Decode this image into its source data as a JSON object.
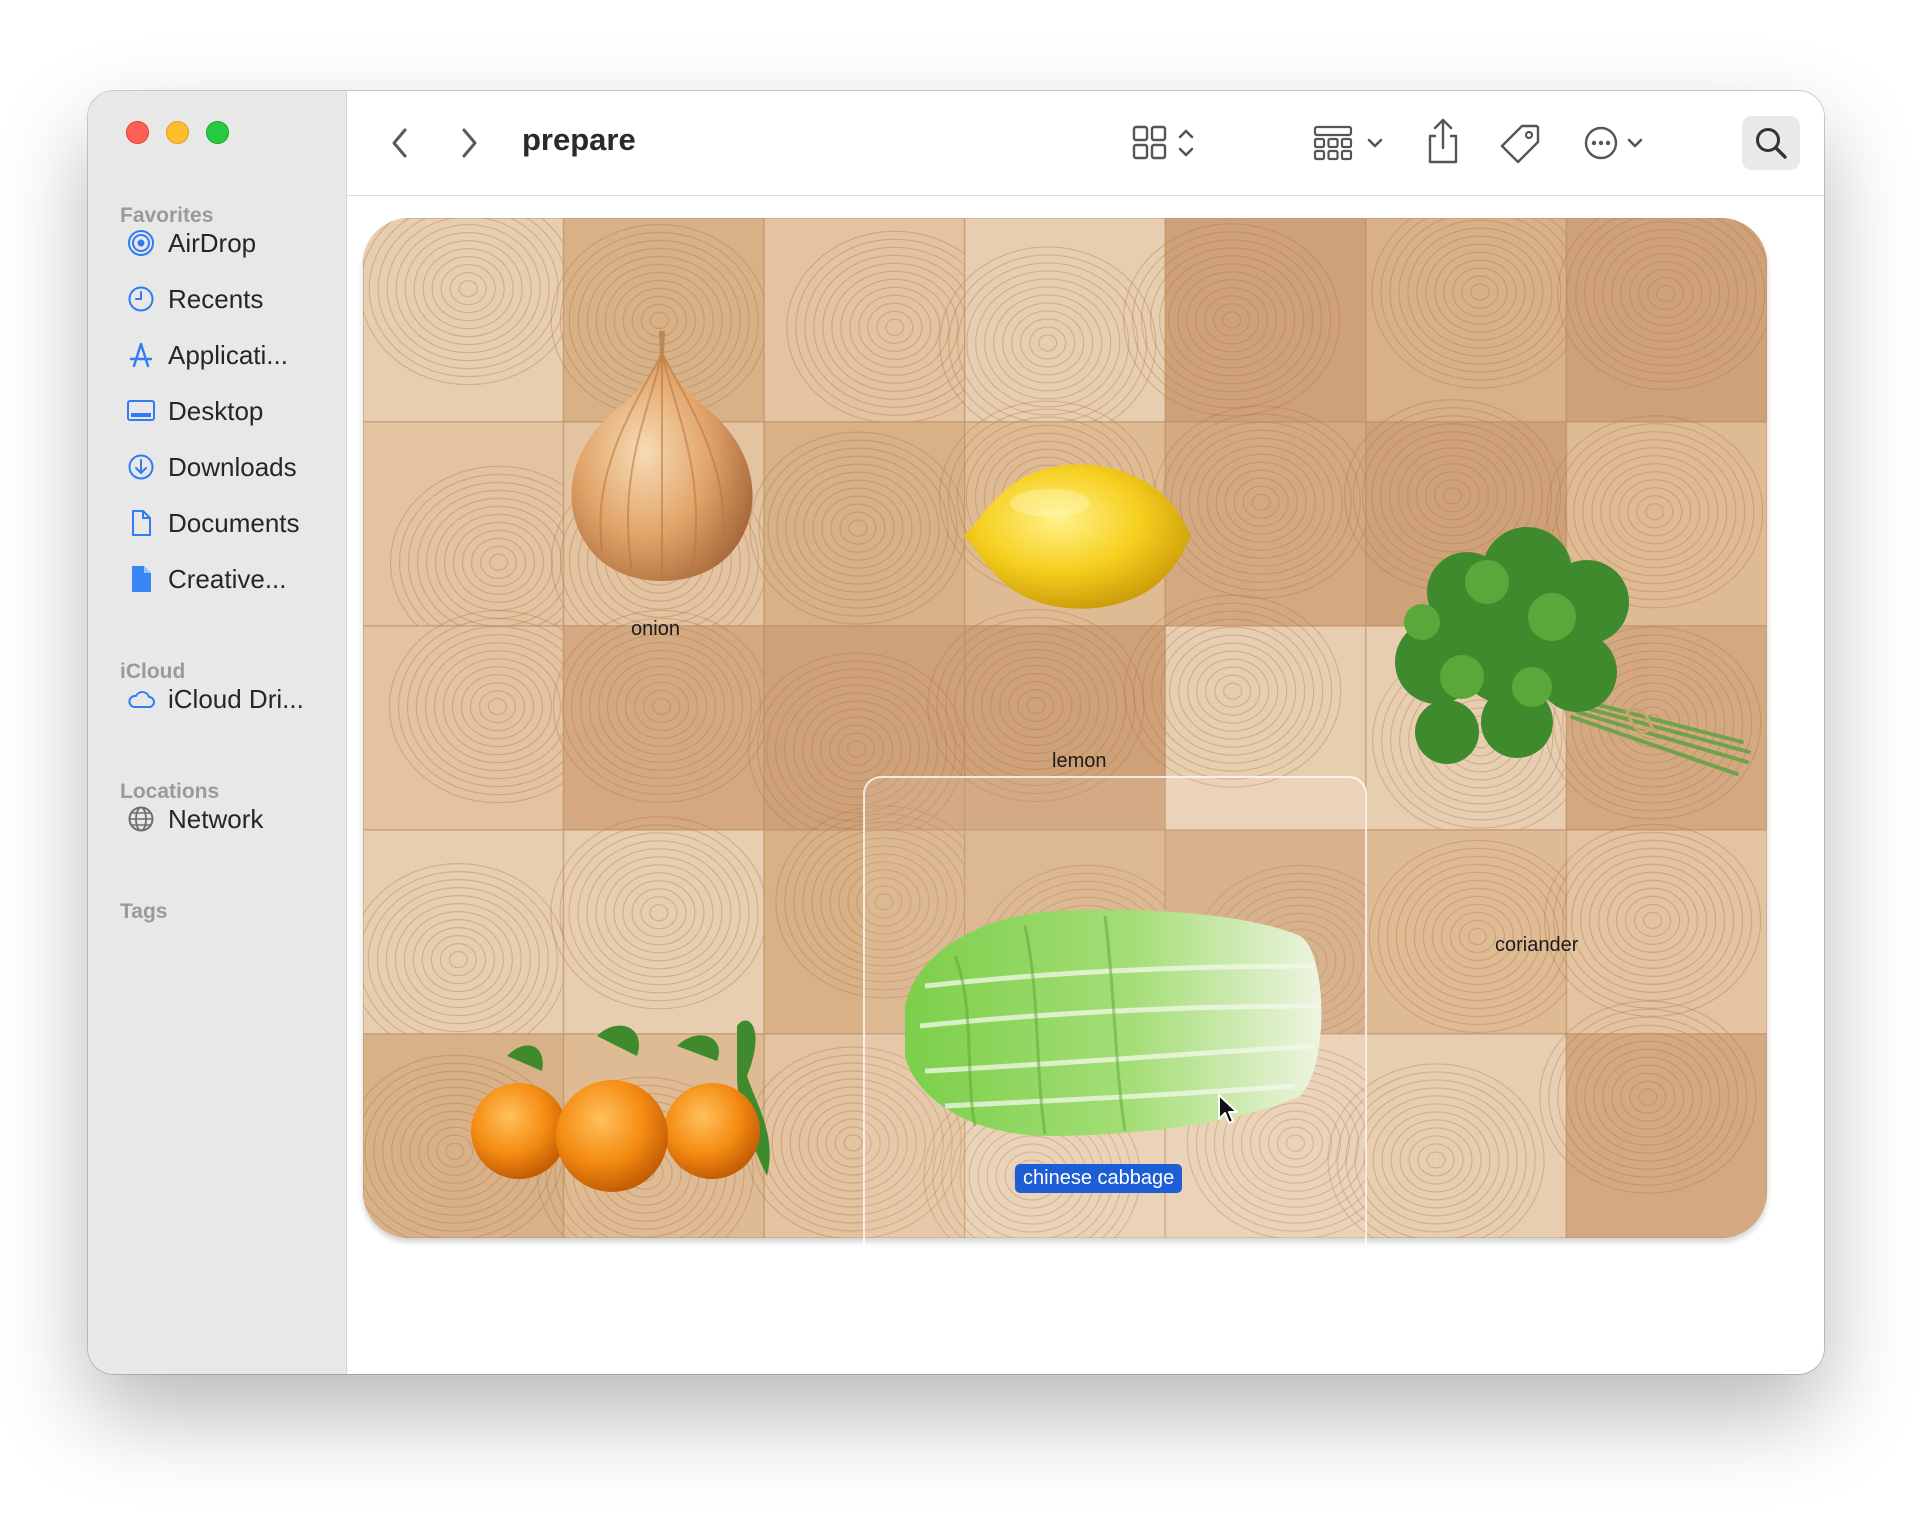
{
  "window": {
    "title": "prepare"
  },
  "sidebar": {
    "sections": [
      {
        "heading": "Favorites"
      },
      {
        "heading": "iCloud"
      },
      {
        "heading": "Locations"
      },
      {
        "heading": "Tags"
      }
    ],
    "favorites": [
      {
        "label": "AirDrop",
        "icon": "airdrop-icon"
      },
      {
        "label": "Recents",
        "icon": "clock-icon"
      },
      {
        "label": "Applicati...",
        "icon": "applications-icon"
      },
      {
        "label": "Desktop",
        "icon": "desktop-icon"
      },
      {
        "label": "Downloads",
        "icon": "download-icon"
      },
      {
        "label": "Documents",
        "icon": "document-icon"
      },
      {
        "label": "Creative...",
        "icon": "file-icon"
      }
    ],
    "icloud": [
      {
        "label": "iCloud Dri...",
        "icon": "cloud-icon"
      }
    ],
    "locations": [
      {
        "label": "Network",
        "icon": "globe-icon"
      }
    ]
  },
  "files": [
    {
      "name": "onion"
    },
    {
      "name": "lemon"
    },
    {
      "name": "coriander"
    },
    {
      "name": "chinese cabbage",
      "selected": true
    },
    {
      "name": "tangerine"
    }
  ],
  "colors": {
    "accent": "#1e5ed4",
    "close": "#fe5f57",
    "minimize": "#febc2e",
    "zoom": "#28c840"
  }
}
